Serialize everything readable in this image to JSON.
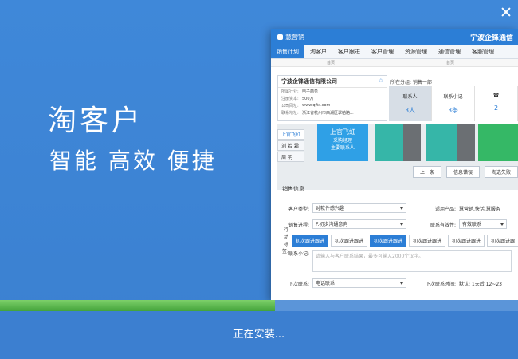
{
  "installer": {
    "title": "淘客户",
    "subtitle": "智能 高效 便捷",
    "status": "正在安装...",
    "progress_percent": 53,
    "colors": {
      "background": "#3f86d6",
      "progress": "#4fb14a"
    }
  },
  "app": {
    "product_name": "慧营销",
    "company_name": "宁波企锋通信",
    "nav": [
      "销售计划",
      "淘客户",
      "客户跟进",
      "客户管理",
      "资源管理",
      "通信管理",
      "客服管理"
    ],
    "breadcrumbs": [
      "首页",
      "首页"
    ],
    "customer": {
      "name": "宁波企锋通信有限公司",
      "rows": [
        {
          "k": "所属行业:",
          "v": "电子商务"
        },
        {
          "k": "注册资本:",
          "v": "500万"
        },
        {
          "k": "公司网址:",
          "v": "www.qftx.com"
        },
        {
          "k": "联系地址:",
          "v": "浙江省杭州市西湖区翠柏路..."
        }
      ]
    },
    "group": "所在分组: 销售一部",
    "stats": [
      {
        "label": "联系人",
        "value": "3人"
      },
      {
        "label": "联系小记",
        "value": "3条"
      },
      {
        "label": "",
        "value": "2"
      }
    ],
    "contacts": [
      "上官飞虹",
      "刘 若 霜",
      "周 明"
    ],
    "contact_card": {
      "name": "上官飞虹",
      "role": "采购经理",
      "tag": "主要联系人"
    },
    "actions": [
      "上一条",
      "信息错误",
      "淘选失败"
    ],
    "form": {
      "section": "销售信息",
      "customer_type_label": "客户类型:",
      "customer_type": "对软件感兴趣",
      "product_label": "适用产品:",
      "product": "慧营销,快话,慧服务",
      "progress_label": "销售进程:",
      "progress": "F.初步沟通意向",
      "validity_label": "联系有效性:",
      "validity": "有效联系",
      "tags_label": "行动标签:",
      "tags": [
        "初次跟进跟进",
        "初次跟进跟进",
        "初次跟进跟进",
        "初次跟进跟进",
        "初次跟进跟进",
        "初次跟进跟"
      ],
      "tags_on": [
        true,
        false,
        true,
        false,
        false,
        false
      ],
      "note_label": "联系小记:",
      "note_placeholder": "请输入与客户联系结果，最多可输入2000个汉字。",
      "next_label": "下次联系:",
      "next_method": "电话联系",
      "next_time_label": "下次联系时间:",
      "next_time": "默认: 1天后 12~23"
    }
  }
}
